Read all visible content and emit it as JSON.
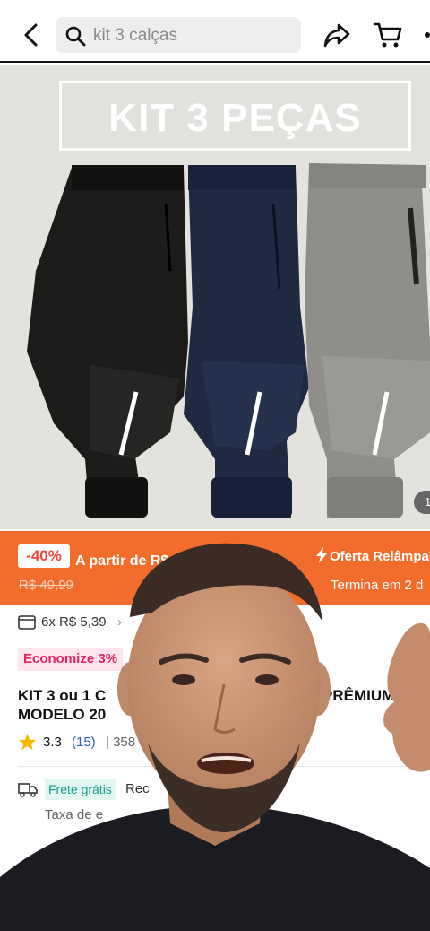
{
  "search": {
    "query": "kit 3 calças"
  },
  "hero": {
    "banner_text": "KIT 3 PEÇAS",
    "image_counter": "1"
  },
  "flash_sale": {
    "discount": "-40%",
    "from_label": "A partir de R$ 7",
    "old_price": "R$ 49,99",
    "offer_label": "Oferta Relâmpago",
    "ends_label": "Termina em 2 d"
  },
  "details": {
    "installments": "6x R$ 5,39",
    "save_badge": "Economize 3%",
    "title_line1": "KIT 3 ou 1 C",
    "title_line1_end": "PRÊMIUM",
    "title_line2": "MODELO 20",
    "rating": "3.3",
    "reviews": "(15)",
    "sold": "| 358",
    "free_shipping": "Frete grátis",
    "receive": "Rec",
    "tax": "Taxa de e"
  },
  "colors": {
    "accent": "#f26d2c",
    "discount_text": "#f0463b",
    "badge_pink": "#e0245e",
    "free_ship_green": "#12a08a"
  }
}
